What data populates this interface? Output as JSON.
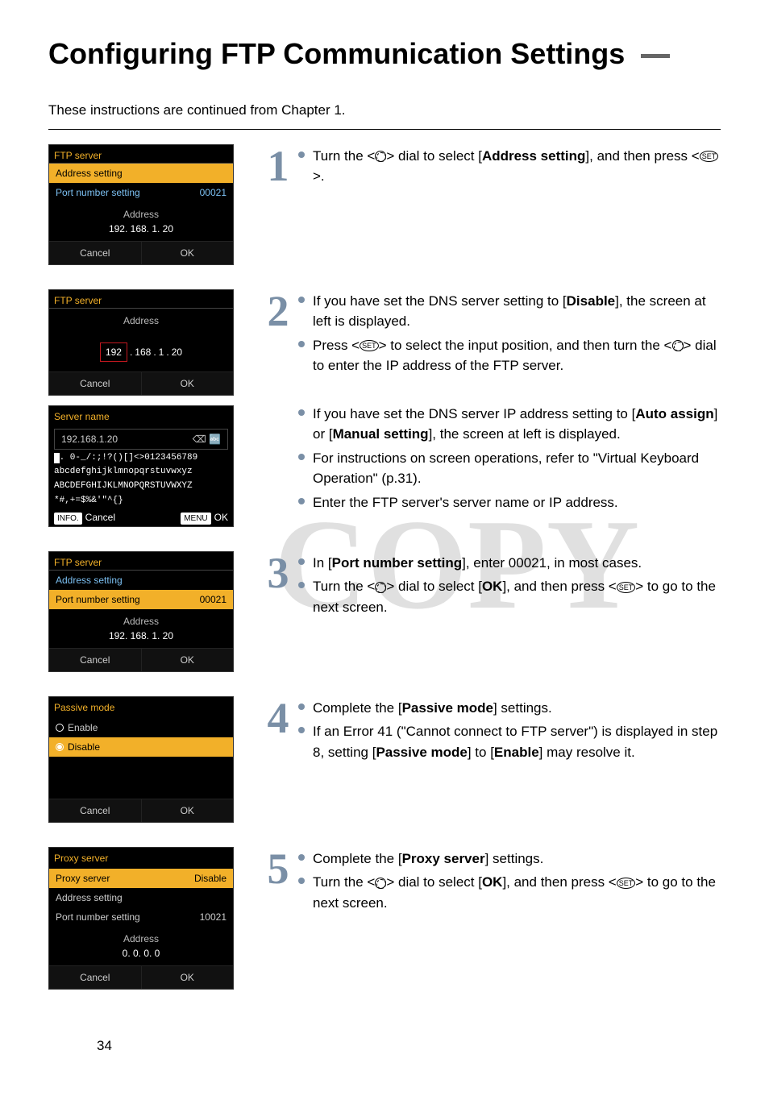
{
  "page_number": "34",
  "title": "Configuring FTP Communication Settings",
  "intro": "These instructions are continued from Chapter 1.",
  "ui": {
    "ftp_server": "FTP server",
    "address_setting": "Address setting",
    "port_number_setting": "Port number setting",
    "port_value": "00021",
    "address_label": "Address",
    "address_value": "192. 168. 1. 20",
    "cancel": "Cancel",
    "ok": "OK",
    "server_name": "Server name",
    "ip_entry_base": "192.168.1.20",
    "octets": [
      "192",
      "168",
      "1",
      "20"
    ],
    "kb_rows": [
      ". 0-_/:;!?()[]<>0123456789",
      "abcdefghijklmnopqrstuvwxyz",
      "ABCDEFGHIJKLMNOPQRSTUVWXYZ",
      "*#,+=$%&'\"^{}"
    ],
    "info_cancel": "Cancel",
    "menu_ok": "OK",
    "info_tag": "INFO.",
    "menu_tag": "MENU",
    "passive_mode": "Passive mode",
    "enable": "Enable",
    "disable": "Disable",
    "proxy_server": "Proxy server",
    "proxy_disable_value": "Disable",
    "proxy_addr_setting": "Address setting",
    "proxy_port_setting": "Port number setting",
    "proxy_port_value": "10021",
    "proxy_addr_value": "0. 0. 0. 0"
  },
  "steps": {
    "s1": {
      "num": "1",
      "items": [
        "Turn the <dial> dial to select [Address setting], and then press <set>."
      ],
      "b1a": "Turn the <",
      "b1b": "> dial to select [",
      "b1c": "Address setting",
      "b1d": "], and then press <",
      "b1e": ">."
    },
    "s2": {
      "num": "2",
      "a1": "If you have set the DNS server setting to [",
      "a2": "Disable",
      "a3": "], the screen at left is displayed.",
      "b1": "Press <",
      "b2": "> to select the input position, and then turn the <",
      "b3": "> dial to enter the IP address of the FTP server.",
      "c1": "If you have set the DNS server IP address setting to [",
      "c2": "Auto assign",
      "c3": "] or [",
      "c4": "Manual setting",
      "c5": "], the screen at left is displayed.",
      "d": "For instructions on screen operations, refer to \"Virtual Keyboard Operation\" (p.31).",
      "e": "Enter the FTP server's server name or IP address."
    },
    "s3": {
      "num": "3",
      "a1": "In [",
      "a2": "Port number setting",
      "a3": "], enter 00021, in most cases.",
      "b1": "Turn the <",
      "b2": "> dial to select [",
      "b3": "OK",
      "b4": "], and then press <",
      "b5": "> to go to the next screen."
    },
    "s4": {
      "num": "4",
      "a1": "Complete the [",
      "a2": "Passive mode",
      "a3": "] settings.",
      "b1": "If an Error 41 (\"Cannot connect to FTP server\") is displayed in step 8, setting [",
      "b2": "Passive mode",
      "b3": "] to [",
      "b4": "Enable",
      "b5": "] may resolve it."
    },
    "s5": {
      "num": "5",
      "a1": "Complete the [",
      "a2": "Proxy server",
      "a3": "] settings.",
      "b1": "Turn the <",
      "b2": "> dial to select [",
      "b3": "OK",
      "b4": "], and then press <",
      "b5": "> to go to the next screen."
    }
  },
  "set_label": "SET"
}
